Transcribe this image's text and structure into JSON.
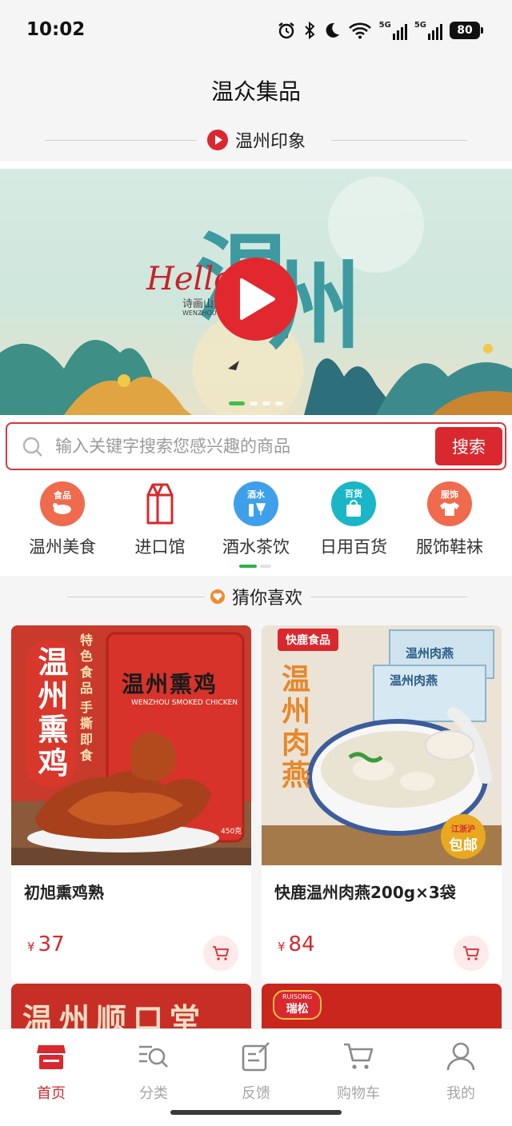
{
  "status_bar": {
    "time": "10:02",
    "battery": "80",
    "signal_1": "5G",
    "signal_2": "5G"
  },
  "header": {
    "title": "温众集品"
  },
  "video_section": {
    "heading": "温州印象"
  },
  "banner": {
    "title_chars": [
      "温",
      "州"
    ],
    "hello": "Hello",
    "subtitle": "诗画山…",
    "caption": "WENZHOU • P…"
  },
  "search": {
    "placeholder": "输入关键字搜索您感兴趣的商品",
    "button": "搜索"
  },
  "categories": [
    {
      "label": "温州美食",
      "badge": "食品",
      "color": "#f06a4d",
      "icon": "food-icon"
    },
    {
      "label": "进口馆",
      "badge": "",
      "color": "#d9282e",
      "icon": "milk-carton-icon"
    },
    {
      "label": "酒水茶饮",
      "badge": "酒水",
      "color": "#3ea0ea",
      "icon": "drinks-icon"
    },
    {
      "label": "日用百货",
      "badge": "百货",
      "color": "#1ab6c8",
      "icon": "shopping-bag-icon"
    },
    {
      "label": "服饰鞋袜",
      "badge": "服饰",
      "color": "#f06a4d",
      "icon": "clothes-icon"
    }
  ],
  "recommend": {
    "heading": "猜你喜欢"
  },
  "products": [
    {
      "name": "初旭熏鸡熟",
      "currency": "¥",
      "price": "37",
      "image_text": {
        "vertical": "温州熏鸡",
        "tags": "特色食品",
        "tags2": "手撕即食",
        "pack_title": "温州熏鸡",
        "pack_sub": "WENZHOU SMOKED CHICKEN",
        "weight": "450克"
      }
    },
    {
      "name": "快鹿温州肉燕200g×3袋",
      "currency": "¥",
      "price": "84",
      "image_text": {
        "brand": "快鹿食品",
        "vertical": "温州肉燕",
        "pack_title": "温州肉燕",
        "stamp": "包邮",
        "stamp_top": "江浙沪"
      }
    }
  ],
  "next_products": [
    {
      "image_text": "温州顺口堂"
    },
    {
      "image_text": "瑞松",
      "brand_en": "RUISONG"
    }
  ],
  "tabbar": [
    {
      "label": "首页",
      "icon": "shop-icon",
      "active": true
    },
    {
      "label": "分类",
      "icon": "category-search-icon",
      "active": false
    },
    {
      "label": "反馈",
      "icon": "feedback-icon",
      "active": false
    },
    {
      "label": "购物车",
      "icon": "cart-icon",
      "active": false
    },
    {
      "label": "我的",
      "icon": "profile-icon",
      "active": false
    }
  ],
  "colors": {
    "accent": "#d9282e",
    "green": "#2fb34a",
    "background": "#f5f5f5"
  }
}
